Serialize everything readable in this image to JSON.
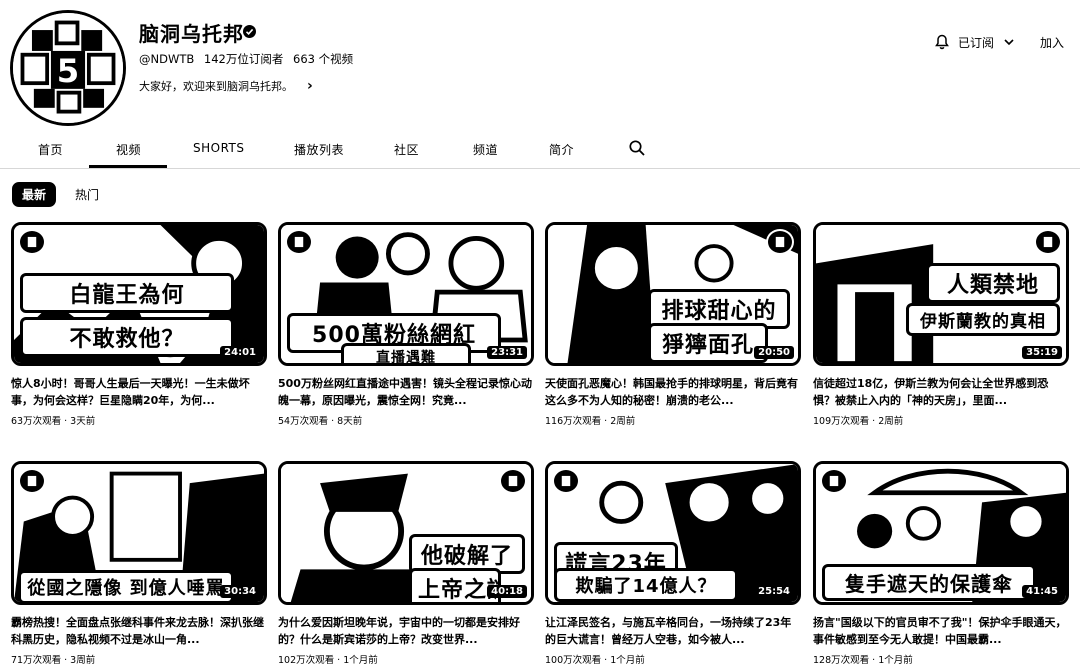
{
  "channel": {
    "name": "脑洞乌托邦",
    "handle": "@NDWTB",
    "subscribers": "142万位订阅者",
    "video_count": "663 个视频",
    "description": "大家好，欢迎来到脑洞乌托邦。",
    "subscribed_label": "已订阅",
    "join_label": "加入"
  },
  "tabs": [
    "首页",
    "视频",
    "SHORTS",
    "播放列表",
    "社区",
    "频道",
    "简介"
  ],
  "filters": {
    "latest": "最新",
    "popular": "热门"
  },
  "videos": [
    {
      "caption1": "白龍王為何",
      "caption2": "不敢救他？",
      "duration": "24:01",
      "title": "惊人8小时！哥哥人生最后一天曝光！一生未做坏事，为何会这样？巨星隐瞒20年，为何...",
      "views": "63万次观看",
      "age": "3天前"
    },
    {
      "caption1": "500萬粉絲網紅",
      "caption2": "直播遇難",
      "duration": "23:31",
      "title": "500万粉丝网红直播途中遇害！镜头全程记录惊心动魄一幕，原因曝光，震惊全网！究竟...",
      "views": "54万次观看",
      "age": "8天前"
    },
    {
      "caption1": "排球甜心的",
      "caption2": "猙獰面孔",
      "duration": "20:50",
      "title": "天使面孔恶魔心！韩国最抢手的排球明星，背后竟有这么多不为人知的秘密！崩溃的老公...",
      "views": "116万次观看",
      "age": "2周前"
    },
    {
      "caption1": "人類禁地",
      "caption2": "伊斯蘭教的真相",
      "duration": "35:19",
      "title": "信徒超过18亿，伊斯兰教为何会让全世界感到恐惧？被禁止入内的「神的天房」，里面...",
      "views": "109万次观看",
      "age": "2周前"
    },
    {
      "caption1": "",
      "caption2": "從國之隱像 到億人唾罵",
      "duration": "30:34",
      "title": "霸榜热搜！全面盘点张继科事件来龙去脉！深扒张继科黑历史，隐私视频不过是冰山一角...",
      "views": "71万次观看",
      "age": "3周前"
    },
    {
      "caption1": "他破解了",
      "caption2": "上帝之謎",
      "duration": "40:18",
      "title": "为什么爱因斯坦晚年说，宇宙中的一切都是安排好的？什么是斯宾诺莎的上帝？改变世界...",
      "views": "102万次观看",
      "age": "1个月前"
    },
    {
      "caption1": "謊言23年",
      "caption2": "欺騙了14億人？",
      "duration": "25:54",
      "title": "让江泽民签名，与施瓦辛格同台，一场持续了23年的巨大谎言！曾经万人空巷，如今被人...",
      "views": "100万次观看",
      "age": "1个月前"
    },
    {
      "caption1": "",
      "caption2": "隻手遮天的保護傘",
      "duration": "41:45",
      "title": "扬言\"国级以下的官员审不了我\"！保护伞手眼通天，事件敏感到至今无人敢提！中国最霸...",
      "views": "128万次观看",
      "age": "1个月前"
    }
  ]
}
